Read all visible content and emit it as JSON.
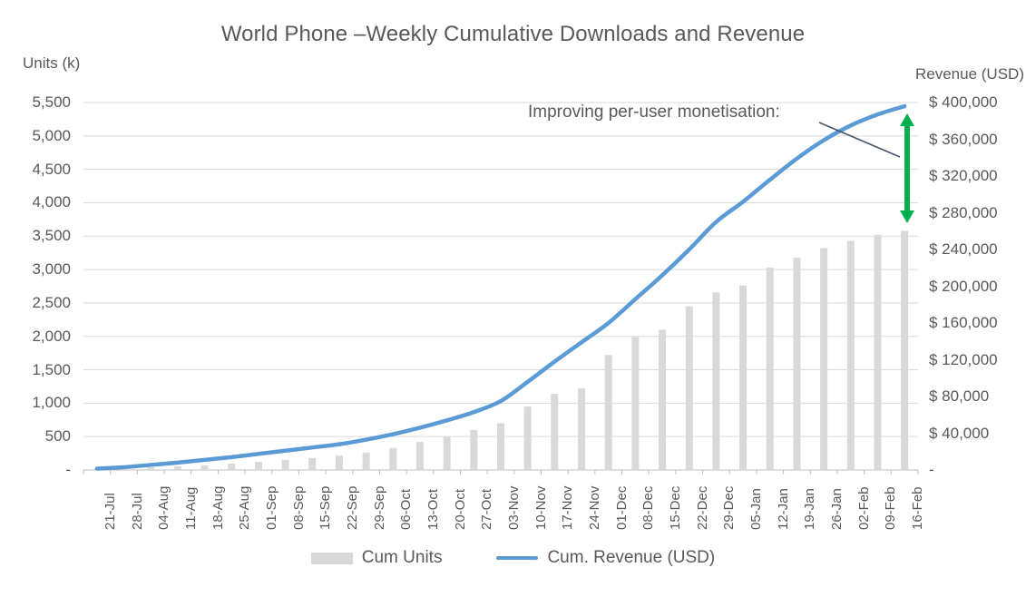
{
  "chart_data": {
    "type": "bar",
    "title": "World Phone –Weekly Cumulative Downloads and Revenue",
    "categories": [
      "21-Jul",
      "28-Jul",
      "04-Aug",
      "11-Aug",
      "18-Aug",
      "25-Aug",
      "01-Sep",
      "08-Sep",
      "15-Sep",
      "22-Sep",
      "29-Sep",
      "06-Oct",
      "13-Oct",
      "20-Oct",
      "27-Oct",
      "03-Nov",
      "10-Nov",
      "17-Nov",
      "24-Nov",
      "01-Dec",
      "08-Dec",
      "15-Dec",
      "22-Dec",
      "29-Dec",
      "05-Jan",
      "12-Jan",
      "19-Jan",
      "26-Jan",
      "02-Feb",
      "09-Feb",
      "16-Feb"
    ],
    "series": [
      {
        "name": "Cum Units",
        "type": "bar",
        "axis": "left",
        "color": "#d9d9d9",
        "values": [
          10,
          25,
          40,
          55,
          70,
          95,
          120,
          150,
          180,
          215,
          260,
          330,
          420,
          500,
          600,
          700,
          950,
          1140,
          1220,
          1720,
          1990,
          2100,
          2450,
          2660,
          2760,
          3030,
          3180,
          3320,
          3430,
          3520,
          3580
        ]
      },
      {
        "name": "Cum. Revenue (USD)",
        "type": "line",
        "axis": "right",
        "color": "#5b9bd5",
        "values": [
          1500,
          3000,
          5500,
          8000,
          11000,
          14000,
          17500,
          21000,
          24500,
          28000,
          33000,
          39000,
          46000,
          54000,
          63000,
          75000,
          96000,
          118000,
          139000,
          160000,
          186000,
          212000,
          240000,
          270000,
          292000,
          316000,
          339000,
          359000,
          375000,
          387000,
          396000
        ]
      }
    ],
    "left_axis": {
      "label": "Units (k)",
      "ticks": [
        "-",
        "500",
        "1,000",
        "1,500",
        "2,000",
        "2,500",
        "3,000",
        "3,500",
        "4,000",
        "4,500",
        "5,000",
        "5,500"
      ],
      "min": 0,
      "max": 5500,
      "step": 500
    },
    "right_axis": {
      "label": "Revenue (USD)",
      "ticks": [
        "-",
        "$ 40,000",
        "$ 80,000",
        "$ 120,000",
        "$ 160,000",
        "$ 200,000",
        "$ 240,000",
        "$ 280,000",
        "$ 320,000",
        "$ 360,000",
        "$ 400,000"
      ],
      "min": 0,
      "max": 400000,
      "step": 40000
    },
    "xlabel": "",
    "grid": true,
    "legend_position": "bottom",
    "legend": [
      {
        "label": "Cum Units",
        "marker": "bar-swatch",
        "color": "#d9d9d9"
      },
      {
        "label": "Cum. Revenue (USD)",
        "marker": "line-swatch",
        "color": "#5b9bd5"
      }
    ],
    "annotations": [
      {
        "text": "Improving per-user monetisation:",
        "leader_line_color": "#44546a",
        "arrow": {
          "name": "monetisation-gap-arrow",
          "color": "#00b050",
          "direction": "double-vertical"
        }
      }
    ]
  }
}
